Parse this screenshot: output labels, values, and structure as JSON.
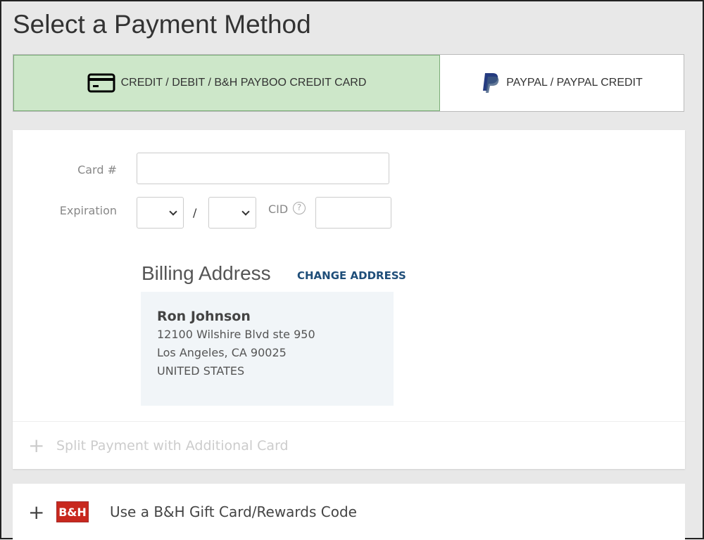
{
  "title": "Select a Payment Method",
  "tabs": [
    {
      "label": "CREDIT / DEBIT / B&H PAYBOO CREDIT CARD",
      "icon": "credit-card-icon",
      "active": true
    },
    {
      "label": "PAYPAL / PAYPAL CREDIT",
      "icon": "paypal-icon"
    }
  ],
  "form": {
    "card_label": "Card #",
    "card_value": "",
    "exp_label": "Expiration",
    "slash": "/",
    "cid_label": "CID",
    "cid_help": "?"
  },
  "billing": {
    "heading": "Billing Address",
    "change": "CHANGE ADDRESS",
    "name": "Ron Johnson",
    "line1": "12100 Wilshire Blvd ste 950",
    "line2": "Los Angeles, CA 90025",
    "country": "UNITED STATES"
  },
  "split": {
    "plus": "+",
    "label": "Split Payment with Additional Card"
  },
  "gift": {
    "plus": "+",
    "logo": "B&H",
    "label": "Use a B&H Gift Card/Rewards Code"
  },
  "colors": {
    "active_tab": "#cde7c9",
    "link": "#1f4e79",
    "logo": "#c8281e"
  }
}
